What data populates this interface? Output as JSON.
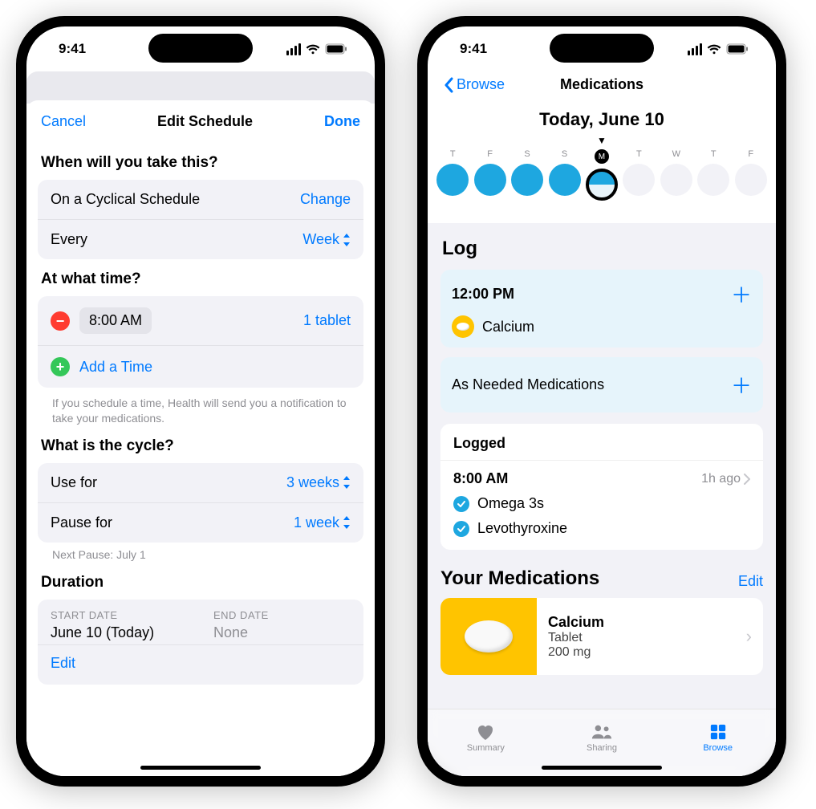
{
  "status": {
    "time": "9:41"
  },
  "phone1": {
    "sheet": {
      "cancel": "Cancel",
      "title": "Edit Schedule",
      "done": "Done"
    },
    "sections": {
      "when": {
        "title": "When will you take this?",
        "schedule_label": "On a Cyclical Schedule",
        "change": "Change",
        "every_label": "Every",
        "every_value": "Week"
      },
      "time": {
        "title": "At what time?",
        "time_value": "8:00 AM",
        "dose": "1 tablet",
        "add_time": "Add a Time",
        "footnote": "If you schedule a time, Health will send you a notification to take your medications."
      },
      "cycle": {
        "title": "What is the cycle?",
        "use_for_label": "Use for",
        "use_for_value": "3 weeks",
        "pause_for_label": "Pause for",
        "pause_for_value": "1 week",
        "next_pause": "Next Pause: July 1"
      },
      "duration": {
        "title": "Duration",
        "start_label": "START DATE",
        "start_value": "June 10 (Today)",
        "end_label": "END DATE",
        "end_value": "None",
        "edit": "Edit"
      }
    }
  },
  "phone2": {
    "nav": {
      "back": "Browse",
      "title": "Medications"
    },
    "date_title": "Today, June 10",
    "week": [
      {
        "letter": "T",
        "state": "full"
      },
      {
        "letter": "F",
        "state": "full"
      },
      {
        "letter": "S",
        "state": "full"
      },
      {
        "letter": "S",
        "state": "full"
      },
      {
        "letter": "M",
        "state": "half",
        "selected": true
      },
      {
        "letter": "T",
        "state": "empty"
      },
      {
        "letter": "W",
        "state": "empty"
      },
      {
        "letter": "T",
        "state": "empty"
      },
      {
        "letter": "F",
        "state": "empty"
      }
    ],
    "log": {
      "heading": "Log",
      "tile_time": "12:00 PM",
      "tile_med": "Calcium",
      "as_needed": "As Needed Medications"
    },
    "logged": {
      "heading": "Logged",
      "time": "8:00 AM",
      "ago": "1h ago",
      "items": [
        "Omega 3s",
        "Levothyroxine"
      ]
    },
    "your_meds": {
      "heading": "Your Medications",
      "edit": "Edit",
      "item": {
        "name": "Calcium",
        "form": "Tablet",
        "strength": "200 mg"
      }
    },
    "tabs": {
      "summary": "Summary",
      "sharing": "Sharing",
      "browse": "Browse"
    }
  }
}
